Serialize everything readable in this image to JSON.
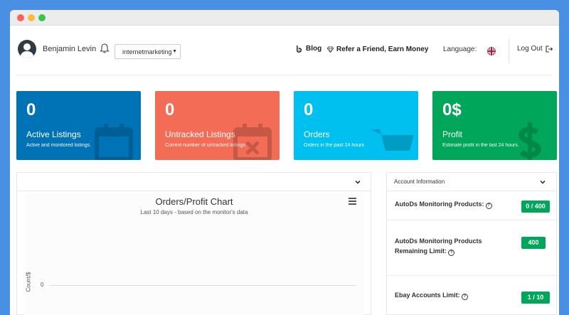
{
  "header": {
    "username": "Benjamin Levin",
    "store_select": "internetmarketing",
    "blog_label": "Blog",
    "refer_label": "Refer a Friend, Earn Money",
    "language_label": "Language:",
    "logout_label": "Log Out"
  },
  "cards": [
    {
      "value": "0",
      "title": "Active Listings",
      "desc": "Active and monitored listings.",
      "color": "#0073b7",
      "icon": "calendar-icon"
    },
    {
      "value": "0",
      "title": "Untracked Listings",
      "desc": "Current number of untracked listings",
      "color": "#f26c56",
      "icon": "calendar-x-icon"
    },
    {
      "value": "0",
      "title": "Orders",
      "desc": "Orders in the past 24 hours",
      "color": "#00c0ef",
      "icon": "cart-icon"
    },
    {
      "value": "0$",
      "title": "Profit",
      "desc": "Estimate profit in the last 24 hours.",
      "color": "#00a65a",
      "icon": "dollar-icon"
    }
  ],
  "chart_panel": {
    "title": "Orders/Profit Chart",
    "subtitle": "Last 10 days - based on the monitor's data"
  },
  "chart_data": {
    "type": "line",
    "title": "Orders/Profit Chart",
    "subtitle": "Last 10 days - based on the monitor's data",
    "ylabel": "Count/$",
    "yticks": [
      "0"
    ],
    "series": []
  },
  "account": {
    "title": "Account Information",
    "rows": [
      {
        "label": "AutoDs Monitoring Products:",
        "value": "0 / 400"
      },
      {
        "label_line1": "AutoDs Monitoring Products",
        "label_line2": "Remaining Limit:",
        "value": "400"
      },
      {
        "label": "Ebay Accounts Limit:",
        "value": "1 / 10"
      }
    ]
  }
}
